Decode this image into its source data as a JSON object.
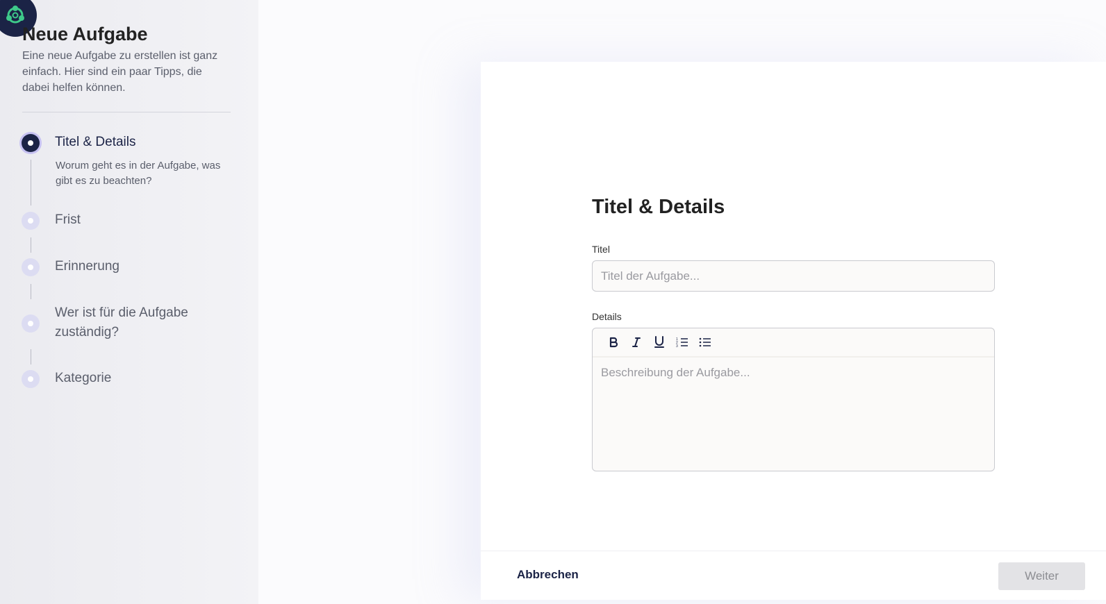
{
  "sidebar": {
    "title": "Neue Aufgabe",
    "subtitle": "Eine neue Aufgabe zu erstellen ist ganz einfach. Hier sind ein paar Tipps, die dabei helfen können.",
    "steps": [
      {
        "label": "Titel & Details",
        "description": "Worum geht es in der Aufgabe, was gibt es zu beachten?",
        "active": true
      },
      {
        "label": "Frist",
        "active": false
      },
      {
        "label": "Erinnerung",
        "active": false
      },
      {
        "label": "Wer ist für die Aufgabe zuständig?",
        "active": false
      },
      {
        "label": "Kategorie",
        "active": false
      }
    ]
  },
  "form": {
    "heading": "Titel & Details",
    "title_label": "Titel",
    "title_placeholder": "Titel der Aufgabe...",
    "details_label": "Details",
    "details_placeholder": "Beschreibung der Aufgabe...",
    "toolbar": [
      "bold-icon",
      "italic-icon",
      "underline-icon",
      "ordered-list-icon",
      "bullet-list-icon"
    ]
  },
  "footer": {
    "cancel_label": "Abbrechen",
    "next_label": "Weiter"
  },
  "colors": {
    "primary": "#1b2346",
    "step_inactive": "#dcdcf2",
    "step_ring": "#c7c2f2",
    "logo_accent": "#3ec98a"
  }
}
